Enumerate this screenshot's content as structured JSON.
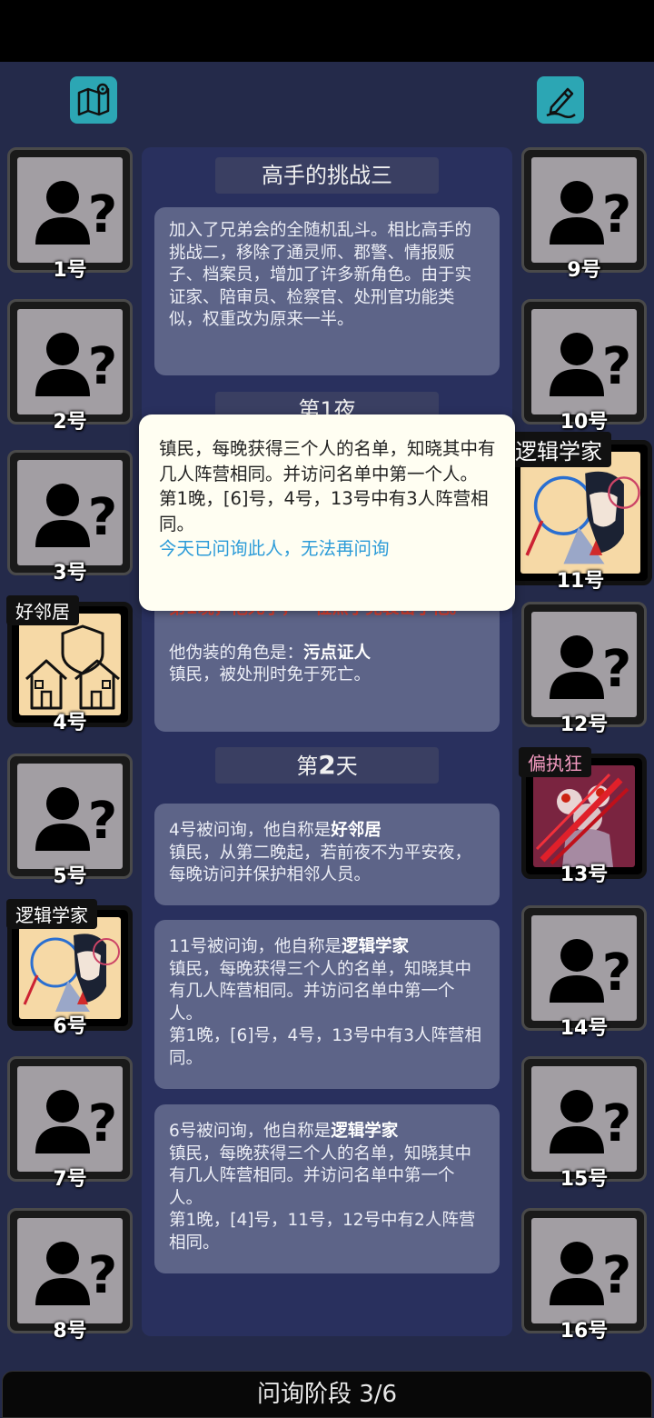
{
  "header": {
    "map_icon": "map-location-icon",
    "notes_icon": "pen-edit-icon"
  },
  "players_left": [
    {
      "num": "1号",
      "role": "",
      "state": "unknown"
    },
    {
      "num": "2号",
      "role": "",
      "state": "unknown"
    },
    {
      "num": "3号",
      "role": "",
      "state": "unknown"
    },
    {
      "num": "4号",
      "role": "好邻居",
      "state": "revealed"
    },
    {
      "num": "5号",
      "role": "",
      "state": "unknown"
    },
    {
      "num": "6号",
      "role": "逻辑学家",
      "state": "revealed"
    },
    {
      "num": "7号",
      "role": "",
      "state": "unknown"
    },
    {
      "num": "8号",
      "role": "",
      "state": "unknown"
    }
  ],
  "players_right": [
    {
      "num": "9号",
      "role": "",
      "state": "unknown"
    },
    {
      "num": "10号",
      "role": "",
      "state": "unknown"
    },
    {
      "num": "11号",
      "role": "逻辑学家",
      "state": "revealed"
    },
    {
      "num": "12号",
      "role": "",
      "state": "unknown"
    },
    {
      "num": "13号",
      "role": "偏执狂",
      "state": "evil"
    },
    {
      "num": "14号",
      "role": "",
      "state": "unknown"
    },
    {
      "num": "15号",
      "role": "",
      "state": "unknown"
    },
    {
      "num": "16号",
      "role": "",
      "state": "unknown"
    }
  ],
  "log": {
    "title": "高手的挑战三",
    "intro": "加入了兄弟会的全随机乱斗。相比高手的挑战二，移除了通灵师、郡警、情报贩子、档案员，增加了许多新角色。由于实证家、陪审员、检察官、处刑官功能类似，权重改为原来一半。",
    "night1_title": "第1夜",
    "night1_death": "第1晚，他死了，一位黑手党袭击了他。",
    "night1_disguise_prefix": "他伪装的角色是：",
    "night1_disguise_role": "污点证人",
    "night1_disguise_desc": "镇民，被处刑时免于死亡。",
    "day2_title_prefix": "第",
    "day2_title_num": "2",
    "day2_title_suffix": "天",
    "entry1_prefix": "4号被问询，他自称是",
    "entry1_role": "好邻居",
    "entry1_desc": "镇民，从第二晚起，若前夜不为平安夜，每晚访问并保护相邻人员。",
    "entry2_prefix": "11号被问询，他自称是",
    "entry2_role": "逻辑学家",
    "entry2_desc": "镇民，每晚获得三个人的名单，知晓其中有几人阵营相同。并访问名单中第一个人。",
    "entry2_result": "第1晚，[6]号，4号，13号中有3人阵营相同。",
    "entry3_prefix": "6号被问询，他自称是",
    "entry3_role": "逻辑学家",
    "entry3_desc": "镇民，每晚获得三个人的名单，知晓其中有几人阵营相同。并访问名单中第一个人。",
    "entry3_result": "第1晚，[4]号，11号，12号中有2人阵营相同。"
  },
  "popup": {
    "desc": "镇民，每晚获得三个人的名单，知晓其中有几人阵营相同。并访问名单中第一个人。",
    "result": "第1晚，[6]号，4号，13号中有3人阵营相同。",
    "notice": "今天已问询此人，无法再问询"
  },
  "footer": {
    "phase_label": "问询阶段 3/6"
  },
  "colors": {
    "background": "#242a4a",
    "panel": "#29305e",
    "card": "#5d6488",
    "accent_icon": "#2ca6b4",
    "evil_tag": "#f39ac0",
    "notice_blue": "#2b9bd8",
    "death_red": "#e2402f"
  }
}
